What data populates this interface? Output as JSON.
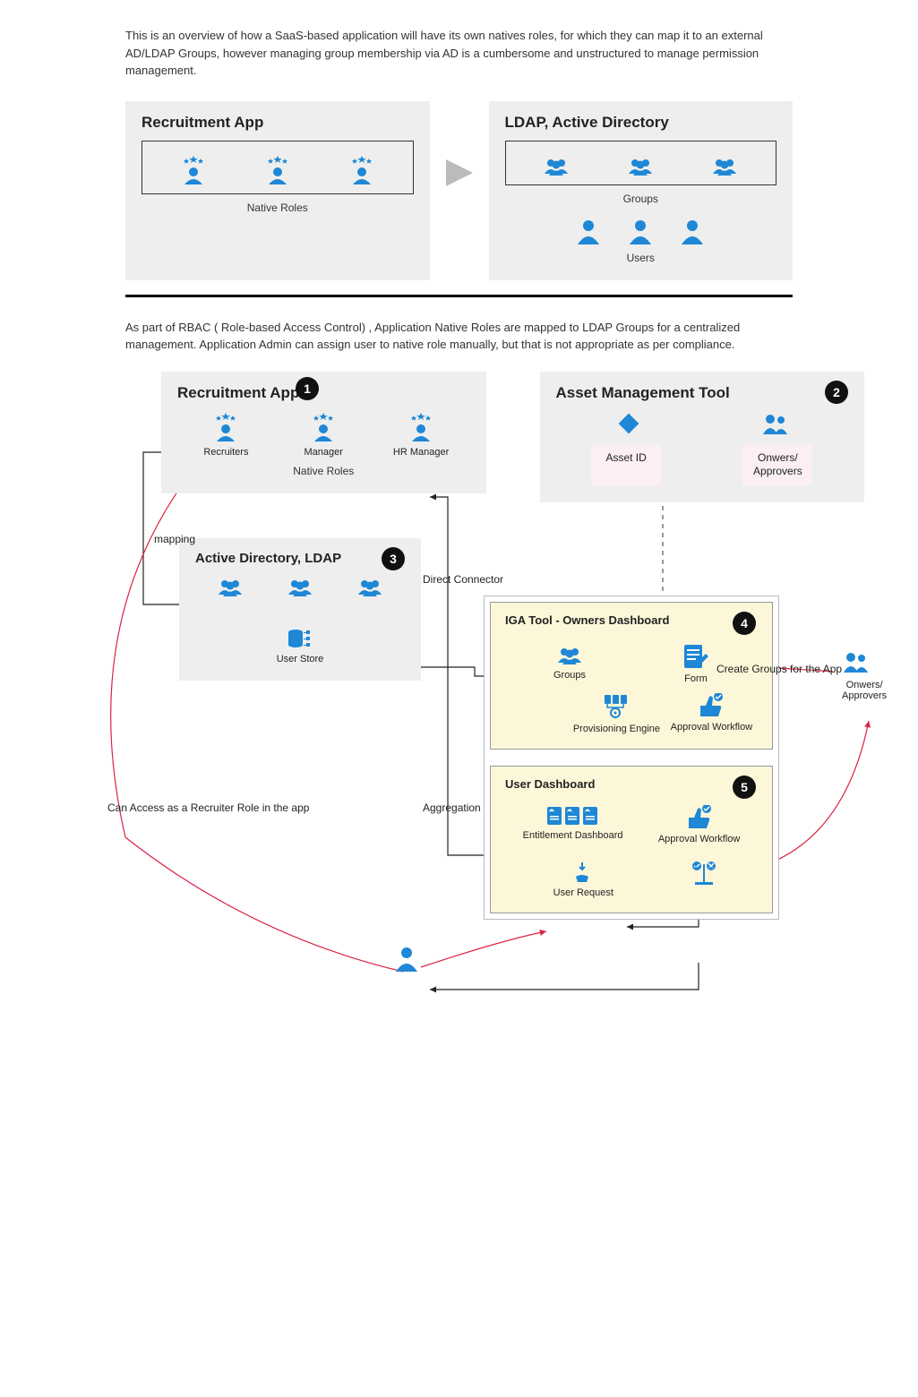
{
  "intro1": "This is an overview of how a SaaS-based application will have its own natives roles, for which they can map it to an external AD/LDAP Groups, however managing group membership via AD is a cumbersome and unstructured to manage permission management.",
  "intro2": "As part of RBAC ( Role-based Access Control) , Application Native Roles are mapped to LDAP Groups for a centralized management. Application Admin can assign user to native role manually, but that is not appropriate as per compliance.",
  "panels": {
    "recruitment": {
      "title": "Recruitment App",
      "native_roles": "Native Roles"
    },
    "ldap": {
      "title": "LDAP, Active Directory",
      "groups": "Groups",
      "users": "Users"
    },
    "asset": {
      "title": "Asset Management Tool",
      "asset_id": "Asset ID",
      "owners": "Onwers/\nApprovers"
    },
    "ad": {
      "title": "Active Directory, LDAP",
      "user_store": "User Store"
    },
    "iga_owners": {
      "title": "IGA Tool - Owners Dashboard",
      "groups": "Groups",
      "form": "Form",
      "prov": "Provisioning Engine",
      "approval": "Approval Workflow"
    },
    "user_dash": {
      "title": "User Dashboard",
      "entitle": "Entitlement Dashboard",
      "approval": "Approval Workflow",
      "user_req": "User Request"
    }
  },
  "roles": {
    "r1": "Recruiters",
    "r2": "Manager",
    "r3": "HR Manager"
  },
  "badges": {
    "b1": "1",
    "b2": "2",
    "b3": "3",
    "b4": "4",
    "b5": "5"
  },
  "labels": {
    "mapping": "mapping",
    "direct_connector": "Direct Connector",
    "aggregation": "Aggregation",
    "create_groups": "Create Groups for the App",
    "access_recruiter": "Can Access as a Recruiter Role in the app",
    "owners_right": "Onwers/\nApprovers"
  }
}
